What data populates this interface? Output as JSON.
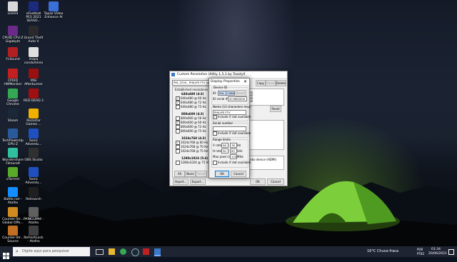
{
  "desktop_icons": [
    {
      "label": "Lixeira",
      "icon": "recycle-bin-icon",
      "color": "#d8d8d8"
    },
    {
      "label": "eFootball PES 2021 SEASO...",
      "icon": "pes-icon",
      "color": "#1b2a7a"
    },
    {
      "label": "Topaz Video Enhance AI",
      "icon": "topaz-icon",
      "color": "#3a6fd8"
    },
    {
      "label": "CPUID CPU-Z Gigabyte",
      "icon": "cpuz-icon",
      "color": "#6a2a8a"
    },
    {
      "label": "Grand Theft Auto V",
      "icon": "gta-icon",
      "color": "#2a2a2a"
    },
    {
      "label": "FcSound",
      "icon": "fcsound-icon",
      "color": "#b02020"
    },
    {
      "label": "mapa condominio",
      "icon": "map-file-icon",
      "color": "#e0e0e0"
    },
    {
      "label": "CPUID HWMonitor",
      "icon": "hwmonitor-icon",
      "color": "#c02020"
    },
    {
      "label": "MSI Afterburner",
      "icon": "afterburner-icon",
      "color": "#9a1010"
    },
    {
      "label": "Google Chrome",
      "icon": "chrome-icon",
      "color": "#34a853"
    },
    {
      "label": "RED DEAD 2",
      "icon": "rdr2-icon",
      "color": "#a01010"
    },
    {
      "label": "Steam",
      "icon": "steam-icon",
      "color": "#1b2838"
    },
    {
      "label": "Rockstar Games ...",
      "icon": "rockstar-icon",
      "color": "#f0b000"
    },
    {
      "label": "TechPowerUp GPU-Z",
      "icon": "gpuz-icon",
      "color": "#2a5a9a"
    },
    {
      "label": "Sonic Adventu...",
      "icon": "sonic-icon",
      "color": "#2050c0"
    },
    {
      "label": "Wondershare Filmora9",
      "icon": "filmora-icon",
      "color": "#30c0a0"
    },
    {
      "label": "OBS Studio",
      "icon": "obs-icon",
      "color": "#303030"
    },
    {
      "label": "uTorrent",
      "icon": "utorrent-icon",
      "color": "#5aaa2a"
    },
    {
      "label": "Sonic Adventu...",
      "icon": "sonic-icon-2",
      "color": "#2050c0"
    },
    {
      "label": "Battle.net - Atalho",
      "icon": "battlenet-icon",
      "color": "#148eff"
    },
    {
      "label": "Retroarch",
      "icon": "retroarch-icon",
      "color": "#202020"
    },
    {
      "label": "Counter-Str... Global Offe...",
      "icon": "csgo-icon",
      "color": "#d08a20"
    },
    {
      "label": "PAINGUIM4 - Atalho",
      "icon": "painguim-icon",
      "color": "#606060"
    },
    {
      "label": "Counter-Str... Source",
      "icon": "css-icon",
      "color": "#c07020"
    },
    {
      "label": "RefreshLock - Atalho",
      "icon": "refreshlock-icon",
      "color": "#404040"
    }
  ],
  "cru_window": {
    "title": "Custom Resolution Utility 1.5.1 by ToastyX",
    "monitor_select": "PHL 2230 - PHILIPS FTV (active)",
    "top_buttons": [
      "Copy",
      "Paste",
      "Delete"
    ],
    "established_title": "Established resolutions",
    "groups": [
      {
        "title": "640x480 (4:3)",
        "items": [
          {
            "text": "640x480 @ 60 Hz",
            "checked": true
          },
          {
            "text": "640x480 @ 72 Hz",
            "checked": true
          },
          {
            "text": "640x480 @ 75 Hz",
            "checked": false
          }
        ]
      },
      {
        "title": "800x600 (4:3)",
        "items": [
          {
            "text": "800x600 @ 56 Hz",
            "checked": false
          },
          {
            "text": "800x600 @ 60 Hz",
            "checked": true
          },
          {
            "text": "800x600 @ 72 Hz",
            "checked": false
          },
          {
            "text": "800x600 @ 75 Hz",
            "checked": false
          }
        ]
      },
      {
        "title": "1024x768 (4:3)",
        "items": [
          {
            "text": "1024x768 @ 60 Hz",
            "checked": true
          },
          {
            "text": "1024x768 @ 70 Hz",
            "checked": false
          },
          {
            "text": "1024x768 @ 75 Hz",
            "checked": false
          }
        ]
      },
      {
        "title": "1280x1024 (5:4)",
        "items": [
          {
            "text": "1280x1024 @ 75 Hz",
            "checked": false
          }
        ]
      }
    ],
    "bottom_left_buttons": [
      "All",
      "None",
      "Reset"
    ],
    "right_list": [
      "Hz",
      "Hz",
      "Hz",
      "Hz"
    ],
    "right_panel_text": "adio device (HDMI)",
    "footer_buttons": [
      "Import...",
      "Export...",
      "OK",
      "Cancel"
    ]
  },
  "display_props": {
    "title": "Display Properties",
    "device_id_label": "Device ID",
    "id_label": "ID:",
    "id_value": "PHL",
    "id_value2": "C0B9",
    "reset_label": "Reset",
    "serial_id_label": "ID serial #:",
    "serial_id_value": "5C3B00000",
    "name_label": "Name (13 characters max)",
    "name_value": "PHILIPS FTV",
    "include_name": "Include if slot available",
    "serial_label": "Serial number",
    "include_serial": "Include if slot available",
    "range_label": "Range limits",
    "vrate_label": "V rate:",
    "vrate_min": "56",
    "vrate_max": "76",
    "vrate_unit": "Hz",
    "hrate_label": "H rate:",
    "hrate_min": "30",
    "hrate_max": "83",
    "hrate_unit": "kHz",
    "pixel_clock_label": "Max pixel clock:",
    "pixel_clock_value": "170",
    "pixel_clock_unit": "MHz",
    "include_range": "Include if slot available",
    "ok_label": "OK",
    "cancel_label": "Cancel"
  },
  "taskbar": {
    "search_placeholder": "Digite aqui para pesquisar",
    "weather": "16°C  Chuva fraca",
    "lang": "POR",
    "lang2": "PTB2",
    "time": "01:34",
    "date": "20/06/2021",
    "accent_color": "#0078d7"
  }
}
